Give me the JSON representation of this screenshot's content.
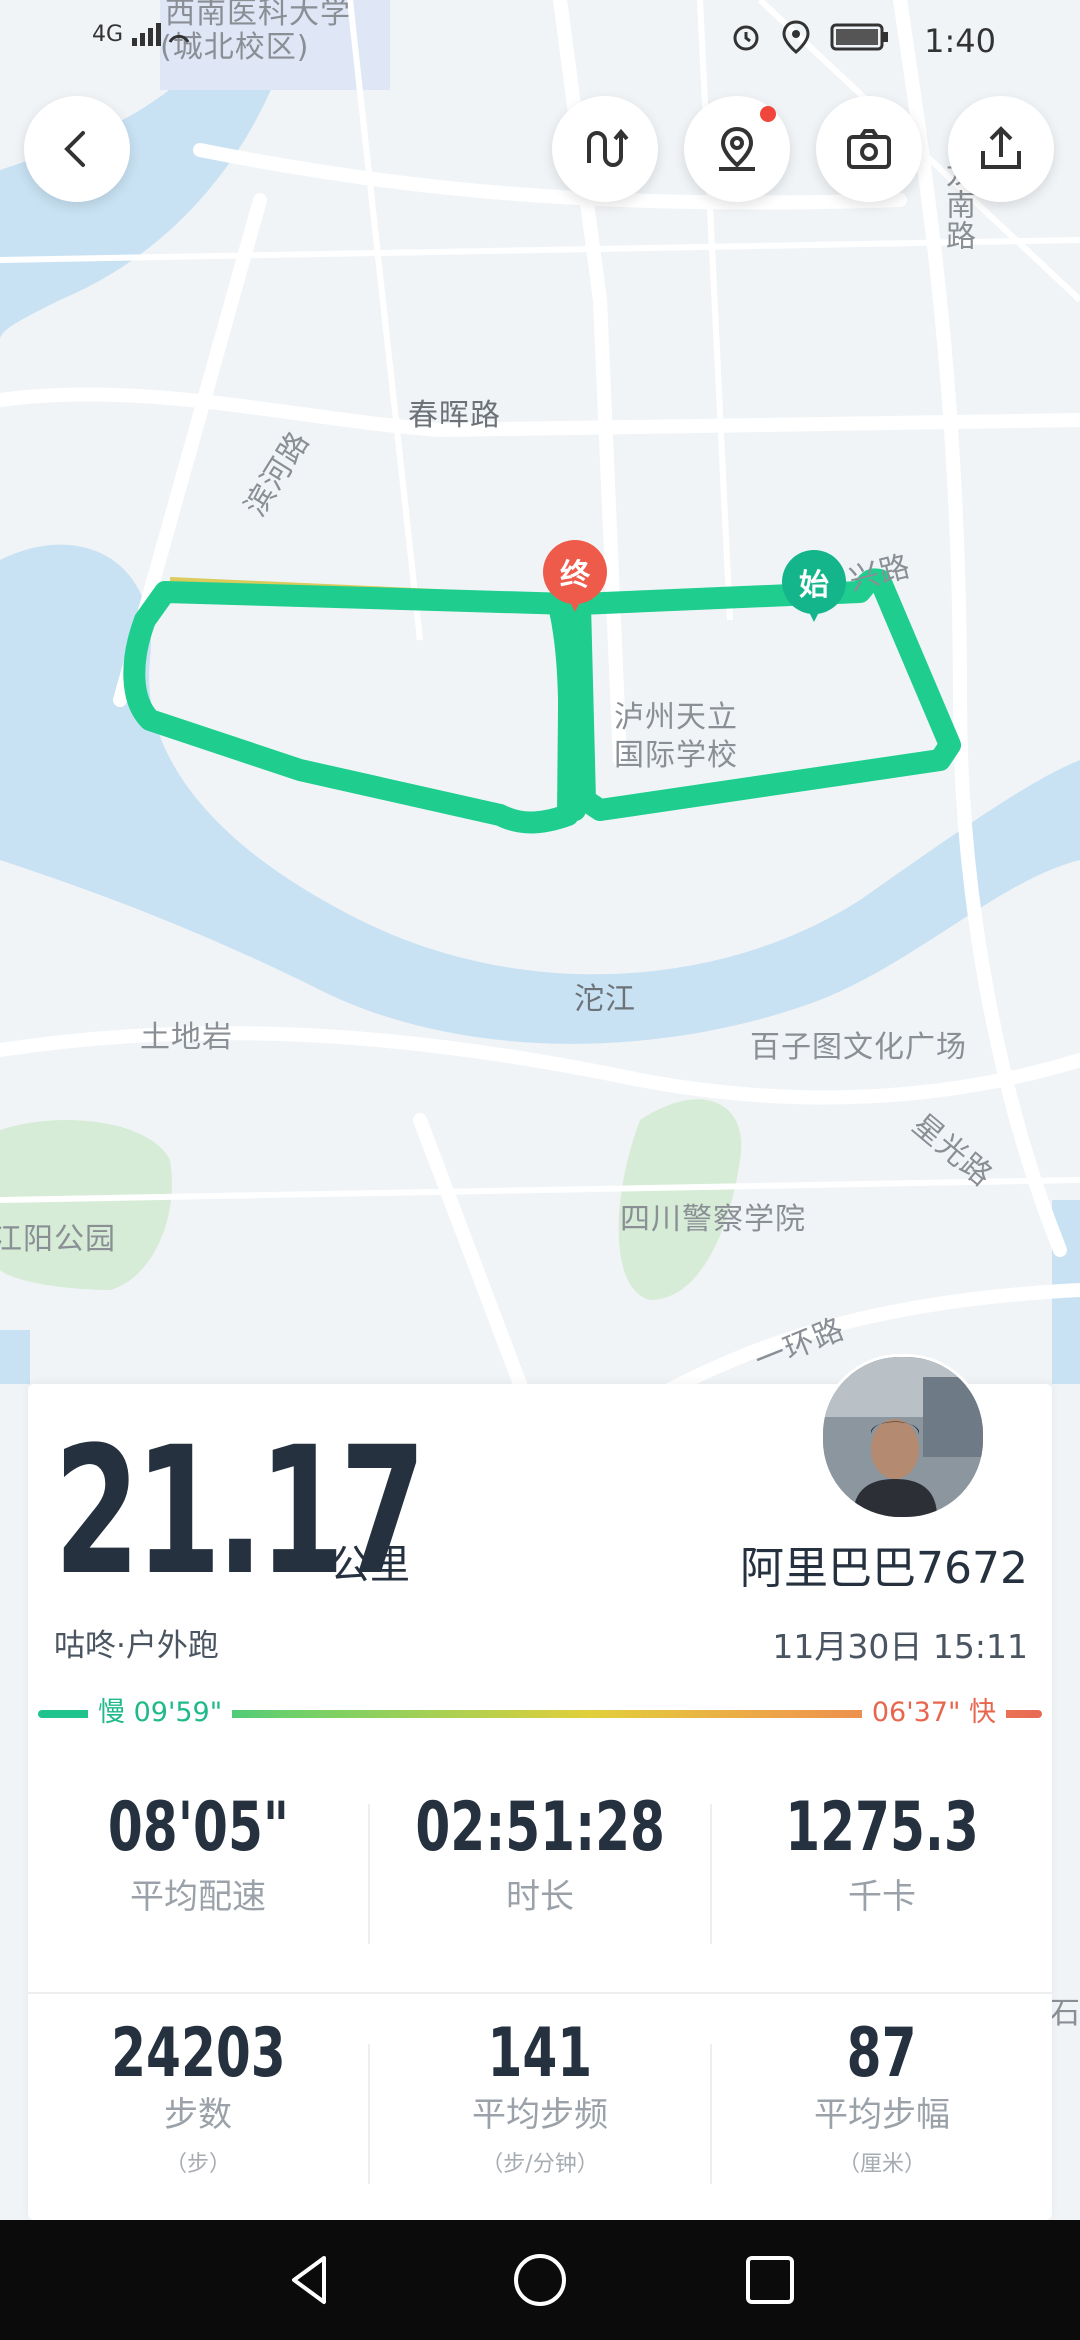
{
  "status_bar": {
    "signal": "4G",
    "time": "1:40"
  },
  "map": {
    "labels": [
      {
        "text": "西南医科大学"
      },
      {
        "text": "(城北校区)"
      },
      {
        "text": "春晖路"
      },
      {
        "text": "滨河路"
      },
      {
        "text": "龙南路"
      },
      {
        "text": "兴路"
      },
      {
        "text": "泸州天立"
      },
      {
        "text": "国际学校"
      },
      {
        "text": "沱江"
      },
      {
        "text": "土地岩"
      },
      {
        "text": "百子图文化广场"
      },
      {
        "text": "星光路"
      },
      {
        "text": "四川警察学院"
      },
      {
        "text": "江阳公园"
      },
      {
        "text": "一环路"
      },
      {
        "text": "石蓝"
      }
    ],
    "start_marker": "始",
    "end_marker": "终",
    "route_color": "#1fce8f"
  },
  "toolbar": {
    "back_icon": "chevron-left-icon",
    "buttons": [
      "route-switch-icon",
      "location-pin-icon",
      "camera-icon",
      "share-icon"
    ]
  },
  "summary": {
    "distance": "21.17",
    "distance_unit": "公里",
    "username": "阿里巴巴7672",
    "activity": "咕咚·户外跑",
    "datetime": "11月30日 15:11",
    "pace_slow": "慢 09'59\"",
    "pace_fast": "06'37\" 快",
    "stats": [
      {
        "value": "08'05\"",
        "label": "平均配速",
        "sub": ""
      },
      {
        "value": "02:51:28",
        "label": "时长",
        "sub": ""
      },
      {
        "value": "1275.3",
        "label": "千卡",
        "sub": ""
      },
      {
        "value": "24203",
        "label": "步数",
        "sub": "（步）"
      },
      {
        "value": "141",
        "label": "平均步频",
        "sub": "（步/分钟）"
      },
      {
        "value": "87",
        "label": "平均步幅",
        "sub": "（厘米）"
      }
    ]
  }
}
